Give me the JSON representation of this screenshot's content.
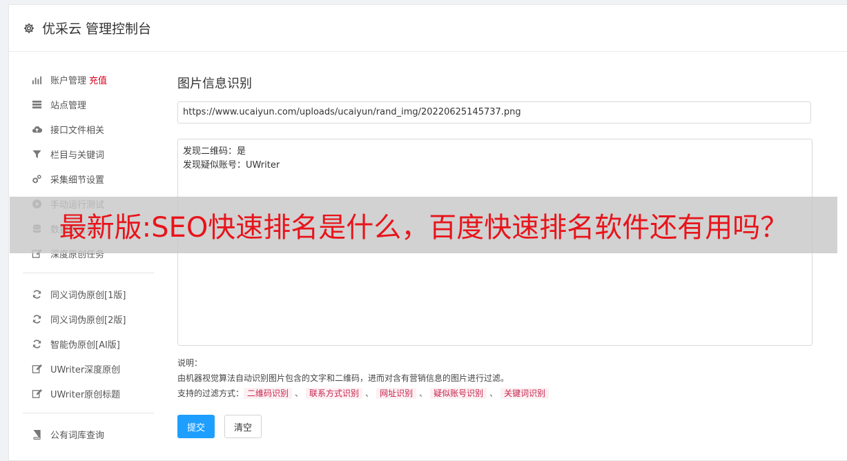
{
  "header": {
    "icon": "gear-icon",
    "title": "优采云 管理控制台"
  },
  "sidebar": {
    "groups": [
      [
        {
          "icon": "bar-chart-icon",
          "label": "账户管理",
          "extra": "充值"
        },
        {
          "icon": "server-icon",
          "label": "站点管理"
        },
        {
          "icon": "cloud-upload-icon",
          "label": "接口文件相关"
        },
        {
          "icon": "filter-icon",
          "label": "栏目与关键词"
        },
        {
          "icon": "cogs-icon",
          "label": "采集细节设置"
        },
        {
          "icon": "play-circle-icon",
          "label": "手动运行测试"
        },
        {
          "icon": "database-icon",
          "label": "数据库管理"
        },
        {
          "icon": "edit-icon",
          "label": "深度原创任务"
        }
      ],
      [
        {
          "icon": "refresh-icon",
          "label": "同义词伪原创[1版]"
        },
        {
          "icon": "refresh-icon",
          "label": "同义词伪原创[2版]"
        },
        {
          "icon": "refresh-icon",
          "label": "智能伪原创[AI版]"
        },
        {
          "icon": "edit-icon",
          "label": "UWriter深度原创"
        },
        {
          "icon": "edit-icon",
          "label": "UWriter原创标题"
        }
      ],
      [
        {
          "icon": "book-icon",
          "label": "公有词库查询"
        }
      ]
    ]
  },
  "main": {
    "title": "图片信息识别",
    "url_value": "https://www.ucaiyun.com/uploads/ucaiyun/rand_img/20220625145737.png",
    "result_lines": [
      "发现二维码：是",
      "发现疑似账号：UWriter"
    ],
    "desc_label": "说明：",
    "desc_text": "由机器视觉算法自动识别图片包含的文字和二维码，进而对含有营销信息的图片进行过滤。",
    "filter_label": "支持的过滤方式：",
    "filter_tags": [
      "二维码识别",
      "联系方式识别",
      "网址识别",
      "疑似账号识别",
      "关键词识别"
    ],
    "filter_sep": "、",
    "submit_label": "提交",
    "clear_label": "清空"
  },
  "overlay": {
    "text": "最新版:SEO快速排名是什么，百度快速排名软件还有用吗？"
  }
}
